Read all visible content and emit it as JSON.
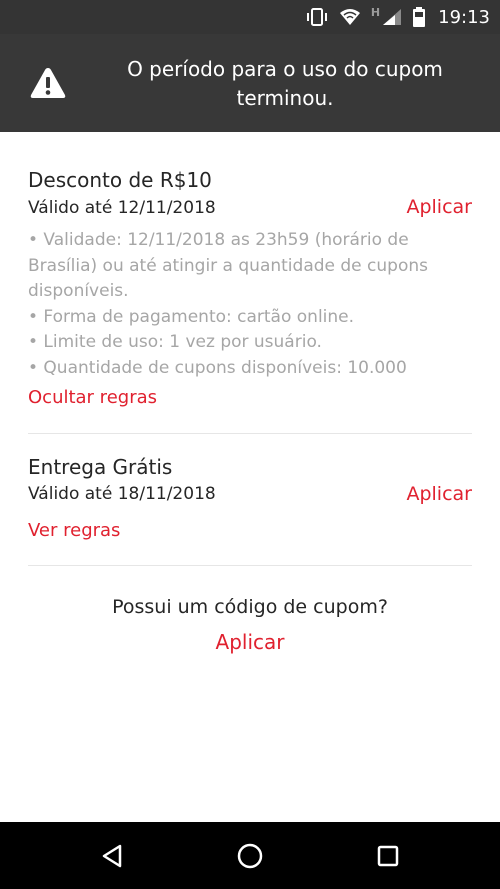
{
  "status_bar": {
    "network_label": "H",
    "time": "19:13"
  },
  "alert": {
    "message": "O período para o uso do cupom terminou.",
    "icon": "warning-icon"
  },
  "coupons": [
    {
      "title": "Desconto de R$10",
      "validity": "Válido até 12/11/2018",
      "apply_label": "Aplicar",
      "rules": [
        "• Validade: 12/11/2018 as 23h59 (horário de Brasília) ou até atingir a quantidade de cupons disponíveis.",
        "• Forma de pagamento: cartão online.",
        "• Limite de uso: 1 vez por usuário.",
        "• Quantidade de cupons disponíveis: 10.000"
      ],
      "rules_toggle_label": "Ocultar regras"
    },
    {
      "title": "Entrega Grátis",
      "validity": "Válido até 18/11/2018",
      "apply_label": "Aplicar",
      "rules_toggle_label": "Ver regras"
    }
  ],
  "coupon_code": {
    "question": "Possui um código de cupom?",
    "apply_label": "Aplicar"
  },
  "colors": {
    "accent": "#e0212f",
    "banner": "#383838",
    "status_bar": "#343434",
    "muted_text": "#a6a6a6"
  }
}
